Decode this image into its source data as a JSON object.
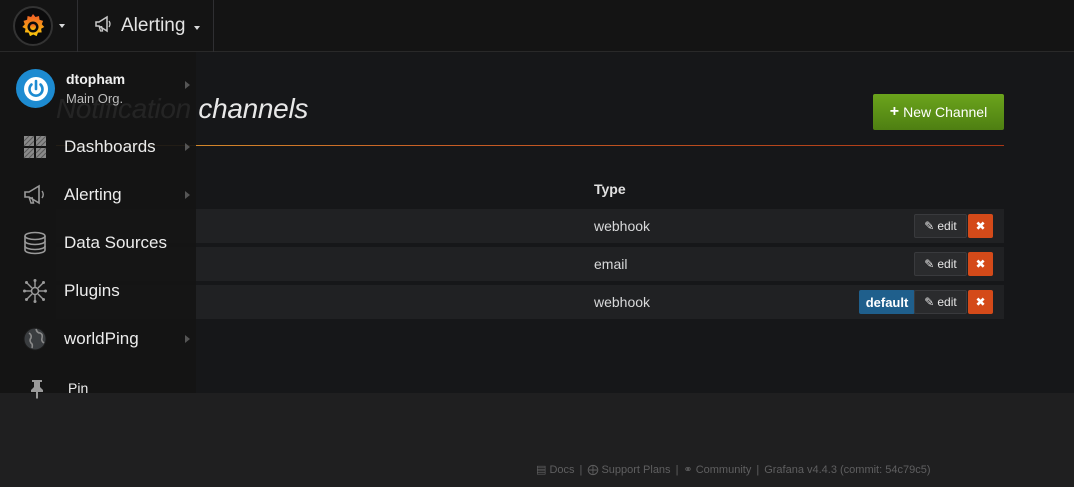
{
  "navbar": {
    "logo_icon": "grafana-logo-icon",
    "section_icon": "megaphone-icon",
    "section_title": "Alerting"
  },
  "page": {
    "title": "Notification channels",
    "new_channel_icon": "plus-icon",
    "new_channel_label": "New Channel",
    "columns": {
      "type": "Type"
    },
    "channels": [
      {
        "type": "webhook",
        "is_default": false
      },
      {
        "type": "email",
        "is_default": false
      },
      {
        "type": "webhook",
        "is_default": true
      }
    ],
    "edit_label": "edit",
    "delete_glyph": "✖",
    "default_label": "default"
  },
  "sidemenu": {
    "user": {
      "name": "dtopham",
      "org": "Main Org."
    },
    "items": [
      {
        "label": "Dashboards",
        "icon": "dashboards-grid-icon",
        "has_submenu": true
      },
      {
        "label": "Alerting",
        "icon": "megaphone-icon",
        "has_submenu": true
      },
      {
        "label": "Data Sources",
        "icon": "database-icon",
        "has_submenu": false
      },
      {
        "label": "Plugins",
        "icon": "plugins-icon",
        "has_submenu": false
      },
      {
        "label": "worldPing",
        "icon": "globe-icon",
        "has_submenu": true
      }
    ],
    "pin": {
      "label": "Pin",
      "icon": "pin-icon"
    }
  },
  "footer": {
    "docs": "Docs",
    "support": "Support Plans",
    "community": "Community",
    "version": "Grafana v4.4.3 (commit: 54c79c5)",
    "separator": "|"
  },
  "colors": {
    "accent_green": "#5b8d18",
    "delete_red": "#d44a19",
    "default_blue": "#1f5f8c",
    "avatar_blue": "#1d8bd1"
  }
}
